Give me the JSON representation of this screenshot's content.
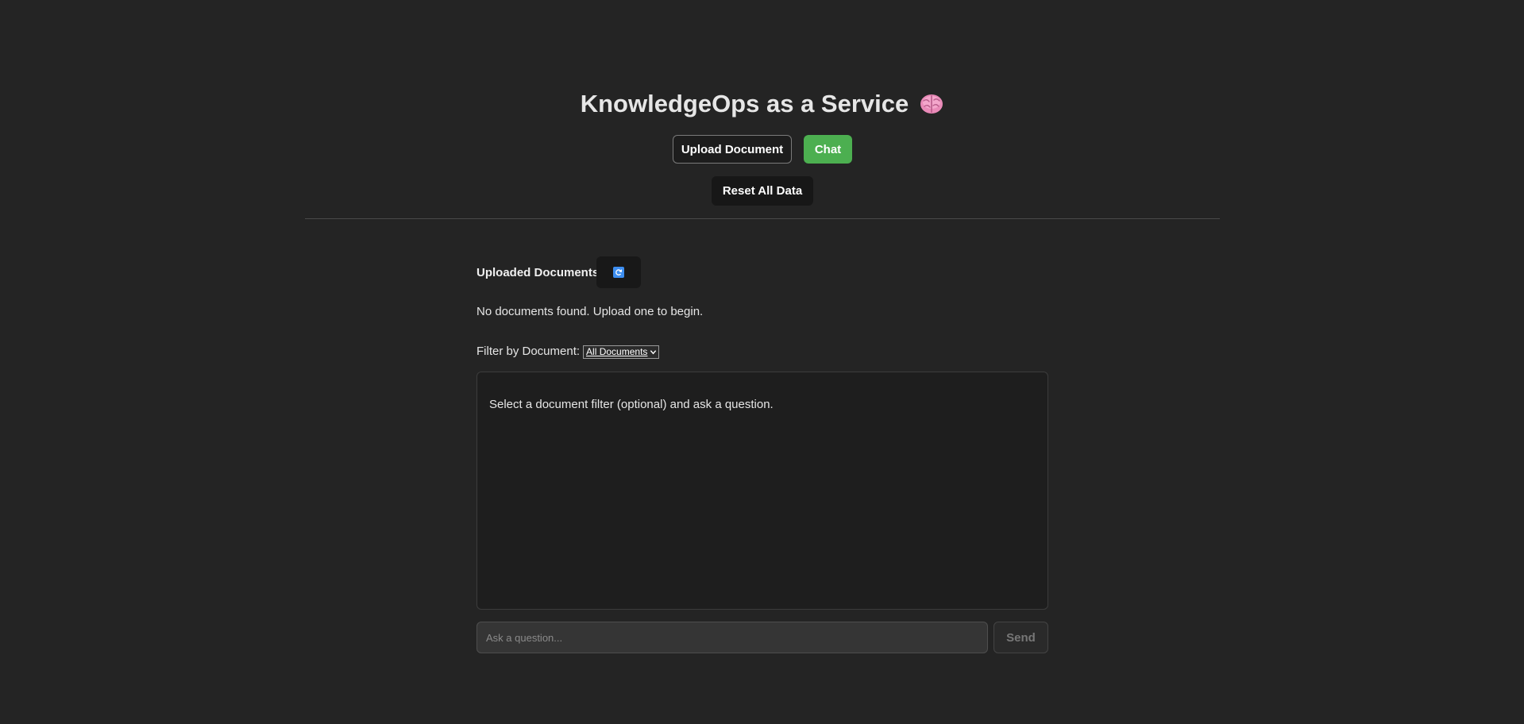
{
  "app": {
    "title": "KnowledgeOps as a Service",
    "title_icon": "brain-icon"
  },
  "nav": {
    "upload_label": "Upload Document",
    "chat_label": "Chat",
    "reset_label": "Reset All Data",
    "active_tab": "Chat"
  },
  "documents": {
    "heading": "Uploaded Documents",
    "refresh_icon": "refresh-icon",
    "empty_message": "No documents found. Upload one to begin."
  },
  "filter": {
    "label": "Filter by Document:",
    "selected": "All Documents"
  },
  "chat": {
    "hint": "Select a document filter (optional) and ask a question.",
    "input_placeholder": "Ask a question...",
    "input_value": "",
    "send_label": "Send"
  },
  "colors": {
    "background": "#242424",
    "accent_green": "#4caf50",
    "refresh_blue": "#3d8ef0"
  }
}
